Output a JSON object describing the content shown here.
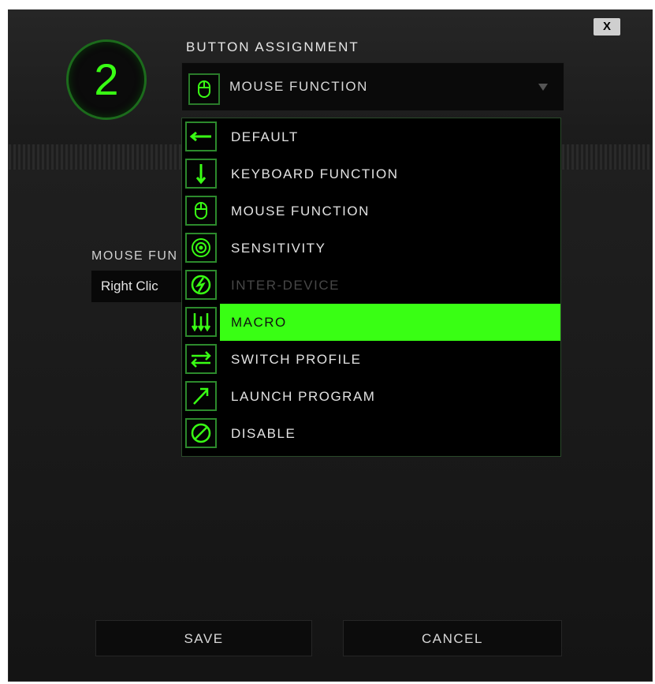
{
  "dialog": {
    "close_label": "X",
    "button_number": "2",
    "title": "BUTTON ASSIGNMENT",
    "selected_function": "MOUSE FUNCTION",
    "selected_icon": "mouse-icon"
  },
  "background_panel": {
    "label": "MOUSE FUN",
    "value": "Right Clic"
  },
  "menu": {
    "items": [
      {
        "label": "DEFAULT",
        "icon": "arrow-left-icon",
        "state": "normal"
      },
      {
        "label": "KEYBOARD FUNCTION",
        "icon": "keyboard-key-icon",
        "state": "normal"
      },
      {
        "label": "MOUSE FUNCTION",
        "icon": "mouse-icon",
        "state": "normal"
      },
      {
        "label": "SENSITIVITY",
        "icon": "target-icon",
        "state": "normal"
      },
      {
        "label": "INTER-DEVICE",
        "icon": "inter-device-icon",
        "state": "disabled"
      },
      {
        "label": "MACRO",
        "icon": "macro-icon",
        "state": "highlighted"
      },
      {
        "label": "SWITCH PROFILE",
        "icon": "switch-arrows-icon",
        "state": "normal"
      },
      {
        "label": "LAUNCH PROGRAM",
        "icon": "launch-arrow-icon",
        "state": "normal"
      },
      {
        "label": "DISABLE",
        "icon": "disable-icon",
        "state": "normal"
      }
    ]
  },
  "footer": {
    "save_label": "SAVE",
    "cancel_label": "CANCEL"
  },
  "colors": {
    "accent": "#39ff14",
    "icon_border": "#2c8a2c",
    "background": "#151515"
  }
}
